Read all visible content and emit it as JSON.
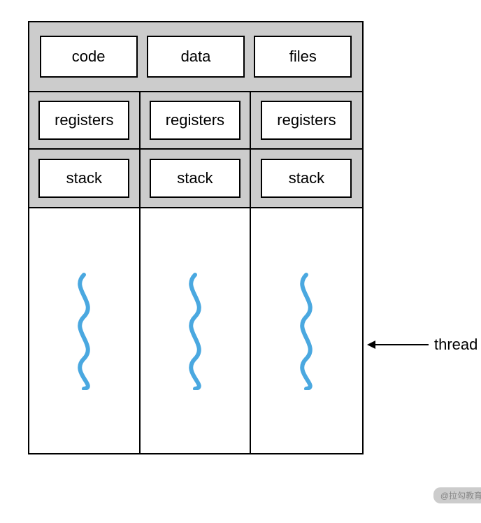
{
  "shared": {
    "items": [
      "code",
      "data",
      "files"
    ]
  },
  "per_thread": {
    "registers": "registers",
    "stack": "stack"
  },
  "threads": {
    "count": 3
  },
  "annotation": {
    "label": "thread"
  },
  "watermark": {
    "text": "@拉勾教育"
  }
}
